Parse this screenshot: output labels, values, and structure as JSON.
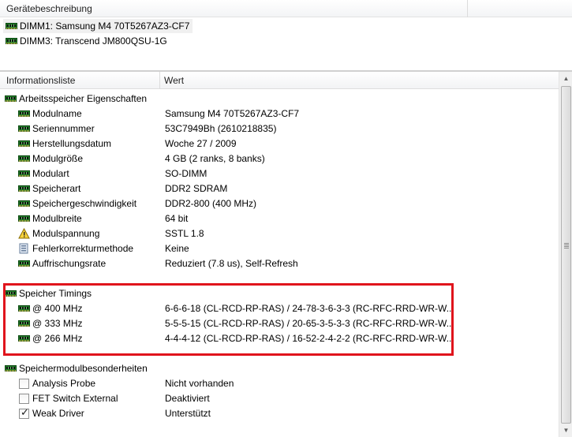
{
  "device_pane": {
    "header": "Gerätebeschreibung",
    "items": [
      {
        "label": "DIMM1: Samsung M4 70T5267AZ3-CF7",
        "selected": true
      },
      {
        "label": "DIMM3: Transcend JM800QSU-1G",
        "selected": false
      }
    ]
  },
  "list": {
    "col_field": "Informationsliste",
    "col_value": "Wert",
    "groups": {
      "props": {
        "title": "Arbeitsspeicher Eigenschaften"
      },
      "timings": {
        "title": "Speicher Timings"
      },
      "features": {
        "title": "Speichermodulbesonderheiten"
      }
    },
    "rows": [
      {
        "name": "Modulname",
        "value": "Samsung M4 70T5267AZ3-CF7",
        "icon": "ram-icon"
      },
      {
        "name": "Seriennummer",
        "value": "53C7949Bh (2610218835)",
        "icon": "ram-icon"
      },
      {
        "name": "Herstellungsdatum",
        "value": "Woche 27 / 2009",
        "icon": "ram-icon"
      },
      {
        "name": "Modulgröße",
        "value": "4 GB (2 ranks, 8 banks)",
        "icon": "ram-icon"
      },
      {
        "name": "Modulart",
        "value": "SO-DIMM",
        "icon": "ram-icon"
      },
      {
        "name": "Speicherart",
        "value": "DDR2 SDRAM",
        "icon": "ram-icon"
      },
      {
        "name": "Speichergeschwindigkeit",
        "value": "DDR2-800 (400 MHz)",
        "icon": "ram-icon"
      },
      {
        "name": "Modulbreite",
        "value": "64 bit",
        "icon": "ram-icon"
      },
      {
        "name": "Modulspannung",
        "value": "SSTL 1.8",
        "icon": "warning-icon"
      },
      {
        "name": "Fehlerkorrekturmethode",
        "value": "Keine",
        "icon": "ecc-icon"
      },
      {
        "name": "Auffrischungsrate",
        "value": "Reduziert (7.8 us), Self-Refresh",
        "icon": "ram-icon"
      }
    ],
    "timings": [
      {
        "name": "@ 400 MHz",
        "value": "6-6-6-18  (CL-RCD-RP-RAS) / 24-78-3-6-3-3  (RC-RFC-RRD-WR-W..."
      },
      {
        "name": "@ 333 MHz",
        "value": "5-5-5-15  (CL-RCD-RP-RAS) / 20-65-3-5-3-3  (RC-RFC-RRD-WR-W..."
      },
      {
        "name": "@ 266 MHz",
        "value": "4-4-4-12  (CL-RCD-RP-RAS) / 16-52-2-4-2-2  (RC-RFC-RRD-WR-W..."
      }
    ],
    "features": [
      {
        "name": "Analysis Probe",
        "value": "Nicht vorhanden",
        "checked": false
      },
      {
        "name": "FET Switch External",
        "value": "Deaktiviert",
        "checked": false
      },
      {
        "name": "Weak Driver",
        "value": "Unterstützt",
        "checked": true
      }
    ]
  },
  "highlight_color": "#e0141c"
}
